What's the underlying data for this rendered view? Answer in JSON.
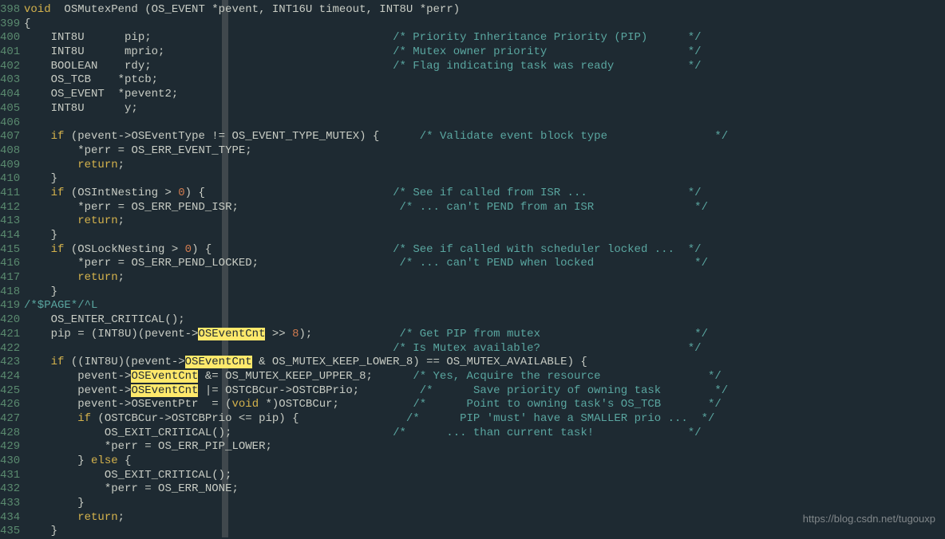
{
  "watermark": "https://blog.csdn.net/tugouxp",
  "lines": [
    {
      "n": 398,
      "segs": [
        {
          "t": "void",
          "c": "kw"
        },
        {
          "t": "  OSMutexPend (OS_EVENT "
        },
        {
          "t": "*",
          "c": "op"
        },
        {
          "t": "pevent, INT16U timeout, INT8U "
        },
        {
          "t": "*",
          "c": "op"
        },
        {
          "t": "perr)"
        }
      ]
    },
    {
      "n": 399,
      "segs": [
        {
          "t": "{"
        }
      ]
    },
    {
      "n": 400,
      "segs": [
        {
          "t": "    INT8U      pip;                                    "
        },
        {
          "t": "/* Priority Inheritance Priority (PIP)      */",
          "c": "cm"
        }
      ]
    },
    {
      "n": 401,
      "segs": [
        {
          "t": "    INT8U      mprio;                                  "
        },
        {
          "t": "/* Mutex owner priority                     */",
          "c": "cm"
        }
      ]
    },
    {
      "n": 402,
      "segs": [
        {
          "t": "    BOOLEAN    rdy;                                    "
        },
        {
          "t": "/* Flag indicating task was ready           */",
          "c": "cm"
        }
      ]
    },
    {
      "n": 403,
      "segs": [
        {
          "t": "    OS_TCB    "
        },
        {
          "t": "*",
          "c": "op"
        },
        {
          "t": "ptcb;"
        }
      ]
    },
    {
      "n": 404,
      "segs": [
        {
          "t": "    OS_EVENT  "
        },
        {
          "t": "*",
          "c": "op"
        },
        {
          "t": "pevent2;"
        }
      ]
    },
    {
      "n": 405,
      "segs": [
        {
          "t": "    INT8U      y;"
        }
      ]
    },
    {
      "n": 406,
      "segs": [
        {
          "t": ""
        }
      ]
    },
    {
      "n": 407,
      "segs": [
        {
          "t": "    "
        },
        {
          "t": "if",
          "c": "kw"
        },
        {
          "t": " (pevent"
        },
        {
          "t": "->",
          "c": "op"
        },
        {
          "t": "OSEventType "
        },
        {
          "t": "!=",
          "c": "op"
        },
        {
          "t": " OS_EVENT_TYPE_MUTEX) {      "
        },
        {
          "t": "/* Validate event block type                */",
          "c": "cm"
        }
      ]
    },
    {
      "n": 408,
      "segs": [
        {
          "t": "        "
        },
        {
          "t": "*",
          "c": "op"
        },
        {
          "t": "perr "
        },
        {
          "t": "=",
          "c": "op"
        },
        {
          "t": " OS_ERR_EVENT_TYPE;"
        }
      ]
    },
    {
      "n": 409,
      "segs": [
        {
          "t": "        "
        },
        {
          "t": "return",
          "c": "kw"
        },
        {
          "t": ";"
        }
      ]
    },
    {
      "n": 410,
      "segs": [
        {
          "t": "    }"
        }
      ]
    },
    {
      "n": 411,
      "segs": [
        {
          "t": "    "
        },
        {
          "t": "if",
          "c": "kw"
        },
        {
          "t": " (OSIntNesting "
        },
        {
          "t": ">",
          "c": "op"
        },
        {
          "t": " "
        },
        {
          "t": "0",
          "c": "num"
        },
        {
          "t": ") {                            "
        },
        {
          "t": "/* See if called from ISR ...               */",
          "c": "cm"
        }
      ]
    },
    {
      "n": 412,
      "segs": [
        {
          "t": "        "
        },
        {
          "t": "*",
          "c": "op"
        },
        {
          "t": "perr "
        },
        {
          "t": "=",
          "c": "op"
        },
        {
          "t": " OS_ERR_PEND_ISR;                        "
        },
        {
          "t": "/* ... can't PEND from an ISR               */",
          "c": "cm"
        }
      ]
    },
    {
      "n": 413,
      "segs": [
        {
          "t": "        "
        },
        {
          "t": "return",
          "c": "kw"
        },
        {
          "t": ";"
        }
      ]
    },
    {
      "n": 414,
      "segs": [
        {
          "t": "    }"
        }
      ]
    },
    {
      "n": 415,
      "segs": [
        {
          "t": "    "
        },
        {
          "t": "if",
          "c": "kw"
        },
        {
          "t": " (OSLockNesting "
        },
        {
          "t": ">",
          "c": "op"
        },
        {
          "t": " "
        },
        {
          "t": "0",
          "c": "num"
        },
        {
          "t": ") {                           "
        },
        {
          "t": "/* See if called with scheduler locked ...  */",
          "c": "cm"
        }
      ]
    },
    {
      "n": 416,
      "segs": [
        {
          "t": "        "
        },
        {
          "t": "*",
          "c": "op"
        },
        {
          "t": "perr "
        },
        {
          "t": "=",
          "c": "op"
        },
        {
          "t": " OS_ERR_PEND_LOCKED;                     "
        },
        {
          "t": "/* ... can't PEND when locked               */",
          "c": "cm"
        }
      ]
    },
    {
      "n": 417,
      "segs": [
        {
          "t": "        "
        },
        {
          "t": "return",
          "c": "kw"
        },
        {
          "t": ";"
        }
      ]
    },
    {
      "n": 418,
      "segs": [
        {
          "t": "    }"
        }
      ]
    },
    {
      "n": 419,
      "segs": [
        {
          "t": "/*$PAGE*/",
          "c": "page"
        },
        {
          "t": "^L",
          "c": "ctrl"
        }
      ]
    },
    {
      "n": 420,
      "segs": [
        {
          "t": "    OS_ENTER_CRITICAL();"
        }
      ]
    },
    {
      "n": 421,
      "segs": [
        {
          "t": "    pip "
        },
        {
          "t": "=",
          "c": "op"
        },
        {
          "t": " (INT8U)(pevent"
        },
        {
          "t": "->",
          "c": "op"
        },
        {
          "t": "OSEventCnt",
          "c": "hl"
        },
        {
          "t": " "
        },
        {
          "t": ">>",
          "c": "op"
        },
        {
          "t": " "
        },
        {
          "t": "8",
          "c": "num"
        },
        {
          "t": ");             "
        },
        {
          "t": "/* Get PIP from mutex                       */",
          "c": "cm"
        }
      ]
    },
    {
      "n": 422,
      "segs": [
        {
          "t": "                                                       "
        },
        {
          "t": "/* Is Mutex available?                      */",
          "c": "cm"
        }
      ]
    },
    {
      "n": 423,
      "segs": [
        {
          "t": "    "
        },
        {
          "t": "if",
          "c": "kw"
        },
        {
          "t": " ((INT8U)(pevent"
        },
        {
          "t": "->",
          "c": "op"
        },
        {
          "t": "OSEventCnt",
          "c": "hl"
        },
        {
          "t": " "
        },
        {
          "t": "&",
          "c": "op"
        },
        {
          "t": " OS_MUTEX_KEEP_LOWER_8) "
        },
        {
          "t": "==",
          "c": "op"
        },
        {
          "t": " OS_MUTEX_AVAILABLE) {"
        }
      ]
    },
    {
      "n": 424,
      "segs": [
        {
          "t": "        pevent"
        },
        {
          "t": "->",
          "c": "op"
        },
        {
          "t": "OSEventCnt",
          "c": "hl"
        },
        {
          "t": " "
        },
        {
          "t": "&=",
          "c": "op"
        },
        {
          "t": " OS_MUTEX_KEEP_UPPER_8;      "
        },
        {
          "t": "/* Yes, Acquire the resource                */",
          "c": "cm"
        }
      ]
    },
    {
      "n": 425,
      "segs": [
        {
          "t": "        pevent"
        },
        {
          "t": "->",
          "c": "op"
        },
        {
          "t": "OSEventCnt",
          "c": "hl"
        },
        {
          "t": " "
        },
        {
          "t": "|=",
          "c": "op"
        },
        {
          "t": " OSTCBCur"
        },
        {
          "t": "->",
          "c": "op"
        },
        {
          "t": "OSTCBPrio;         "
        },
        {
          "t": "/*      Save priority of owning task        */",
          "c": "cm"
        }
      ]
    },
    {
      "n": 426,
      "segs": [
        {
          "t": "        pevent"
        },
        {
          "t": "->",
          "c": "op"
        },
        {
          "t": "OSEventPtr  "
        },
        {
          "t": "=",
          "c": "op"
        },
        {
          "t": " ("
        },
        {
          "t": "void",
          "c": "kw"
        },
        {
          "t": " "
        },
        {
          "t": "*",
          "c": "op"
        },
        {
          "t": ")OSTCBCur;           "
        },
        {
          "t": "/*      Point to owning task's OS_TCB       */",
          "c": "cm"
        }
      ]
    },
    {
      "n": 427,
      "segs": [
        {
          "t": "        "
        },
        {
          "t": "if",
          "c": "kw"
        },
        {
          "t": " (OSTCBCur"
        },
        {
          "t": "->",
          "c": "op"
        },
        {
          "t": "OSTCBPrio "
        },
        {
          "t": "<=",
          "c": "op"
        },
        {
          "t": " pip) {                "
        },
        {
          "t": "/*      PIP 'must' have a SMALLER prio ...  */",
          "c": "cm"
        }
      ]
    },
    {
      "n": 428,
      "segs": [
        {
          "t": "            OS_EXIT_CRITICAL();                        "
        },
        {
          "t": "/*      ... than current task!              */",
          "c": "cm"
        }
      ]
    },
    {
      "n": 429,
      "segs": [
        {
          "t": "            "
        },
        {
          "t": "*",
          "c": "op"
        },
        {
          "t": "perr "
        },
        {
          "t": "=",
          "c": "op"
        },
        {
          "t": " OS_ERR_PIP_LOWER;"
        }
      ]
    },
    {
      "n": 430,
      "segs": [
        {
          "t": "        } "
        },
        {
          "t": "else",
          "c": "kw"
        },
        {
          "t": " {"
        }
      ]
    },
    {
      "n": 431,
      "segs": [
        {
          "t": "            OS_EXIT_CRITICAL();"
        }
      ]
    },
    {
      "n": 432,
      "segs": [
        {
          "t": "            "
        },
        {
          "t": "*",
          "c": "op"
        },
        {
          "t": "perr "
        },
        {
          "t": "=",
          "c": "op"
        },
        {
          "t": " OS_ERR_NONE;"
        }
      ]
    },
    {
      "n": 433,
      "segs": [
        {
          "t": "        }"
        }
      ]
    },
    {
      "n": 434,
      "segs": [
        {
          "t": "        "
        },
        {
          "t": "return",
          "c": "kw"
        },
        {
          "t": ";"
        }
      ]
    },
    {
      "n": 435,
      "segs": [
        {
          "t": "    }"
        }
      ]
    }
  ]
}
